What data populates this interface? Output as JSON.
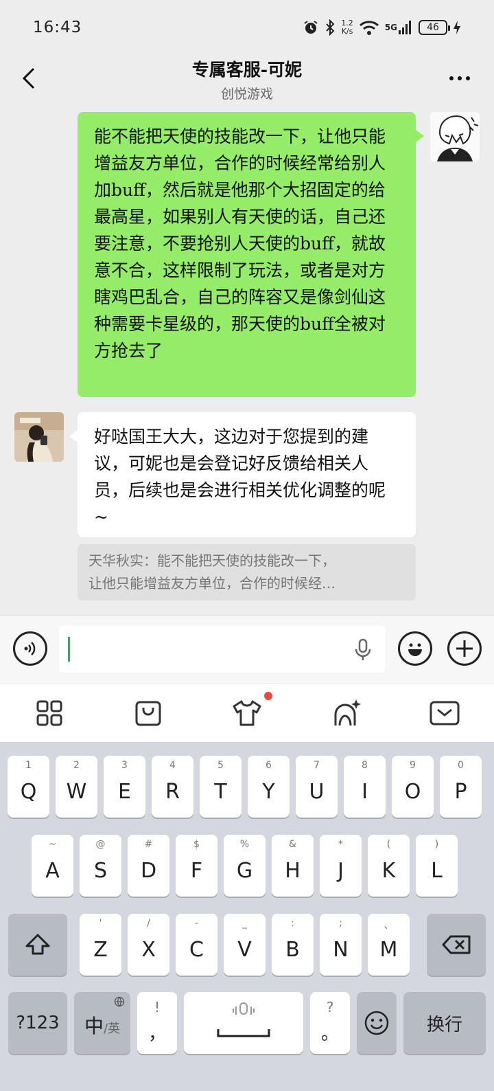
{
  "status_bar": {
    "time": "16:43",
    "net_speed_value": "1.2",
    "net_speed_unit": "K/s",
    "network": "5G",
    "battery": "46"
  },
  "header": {
    "title": "专属客服-可妮",
    "subtitle": "创悦游戏"
  },
  "messages": {
    "sent_text": "能不能把天使的技能改一下，让他只能增益友方单位，合作的时候经常给别人加buff，然后就是他那个大招固定的给最高星，如果别人有天使的话，自己还要注意，不要抢别人天使的buff，就故意不合，这样限制了玩法，或者是对方瞎鸡巴乱合，自己的阵容又是像剑仙这种需要卡星级的，那天使的buff全被对方抢去了",
    "received_text": "好哒国王大大，这边对于您提到的建议，可妮也是会登记好反馈给相关人员，后续也是会进行相关优化调整的呢~",
    "quote_line1": "天华秋实：能不能把天使的技能改一下，",
    "quote_line2": "让他只能增益友方单位，合作的时候经…"
  },
  "input": {
    "value": ""
  },
  "keyboard": {
    "row1": [
      {
        "main": "Q",
        "sub": "1"
      },
      {
        "main": "W",
        "sub": "2"
      },
      {
        "main": "E",
        "sub": "3"
      },
      {
        "main": "R",
        "sub": "4"
      },
      {
        "main": "T",
        "sub": "5"
      },
      {
        "main": "Y",
        "sub": "6"
      },
      {
        "main": "U",
        "sub": "7"
      },
      {
        "main": "I",
        "sub": "8"
      },
      {
        "main": "O",
        "sub": "9"
      },
      {
        "main": "P",
        "sub": "0"
      }
    ],
    "row2": [
      {
        "main": "A",
        "sub": "~"
      },
      {
        "main": "S",
        "sub": "@"
      },
      {
        "main": "D",
        "sub": "#"
      },
      {
        "main": "F",
        "sub": "$"
      },
      {
        "main": "G",
        "sub": "%"
      },
      {
        "main": "H",
        "sub": "&"
      },
      {
        "main": "J",
        "sub": "*"
      },
      {
        "main": "K",
        "sub": "("
      },
      {
        "main": "L",
        "sub": ")"
      }
    ],
    "row3": [
      {
        "main": "Z",
        "sub": "'"
      },
      {
        "main": "X",
        "sub": "/"
      },
      {
        "main": "C",
        "sub": "-"
      },
      {
        "main": "V",
        "sub": "_"
      },
      {
        "main": "B",
        "sub": ":"
      },
      {
        "main": "N",
        "sub": ";"
      },
      {
        "main": "M",
        "sub": "、"
      }
    ],
    "symbols_key": "?123",
    "lang_main": "中",
    "lang_alt": "/英",
    "comma_main": "，",
    "comma_sub": "!",
    "period_main": "。",
    "period_sub": "?",
    "enter_key": "换行"
  },
  "icons": {
    "back": "chevron-left-icon",
    "more": "more-dots-icon",
    "voice": "voice-icon",
    "mic": "mic-icon",
    "emoji": "emoji-icon",
    "plus": "plus-icon",
    "apps": "grid-icon",
    "clipboard": "clipboard-icon",
    "skin": "tshirt-icon",
    "ai": "ai-sparkle-icon",
    "hide_keyboard": "keyboard-hide-icon"
  },
  "colors": {
    "sent_bubble": "#95ec69",
    "received_bubble": "#ffffff",
    "caret": "#07c160",
    "notification_dot": "#e84a3d"
  }
}
